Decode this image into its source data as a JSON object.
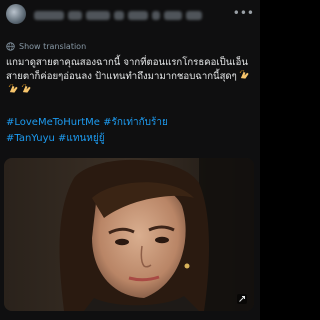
{
  "tweet": {
    "more_icon": "ellipsis-icon",
    "translate_label": "Show translation",
    "text": "แกมาดูสายตาคุณสองฉากนี้ จากที่ตอนแรกโกรธคอเป็นเอ็น สายตาก็ค่อยๆอ่อนลง ป้าแทนทำถึงมามากชอบฉากนี้สุดๆ",
    "emojis": [
      "clapping-hands-emoji",
      "clapping-hands-emoji",
      "clapping-hands-emoji"
    ],
    "hashtags": [
      [
        "#LoveMeToHurtMe",
        "#รักเท่ากับร้าย"
      ],
      [
        "#TanYuyu",
        "#แทนหยู่ยู้"
      ]
    ],
    "link_color": "#1d9bf0",
    "media_badge_icon": "expand-icon"
  }
}
